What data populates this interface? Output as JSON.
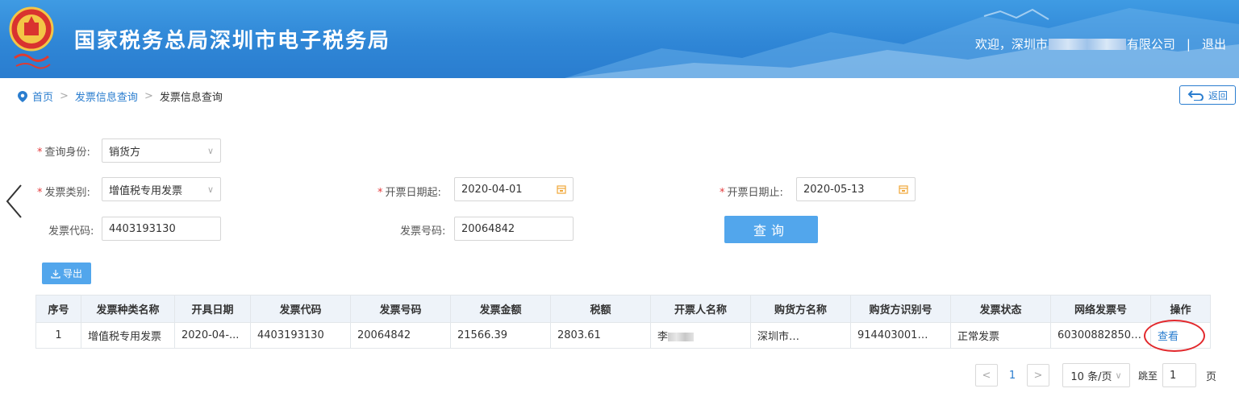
{
  "header": {
    "title": "国家税务总局深圳市电子税务局",
    "welcome_prefix": "欢迎，深圳市",
    "welcome_suffix": "有限公司",
    "separator": "|",
    "logout": "退出"
  },
  "breadcrumb": {
    "home": "首页",
    "separator": ">",
    "level1": "发票信息查询",
    "current": "发票信息查询"
  },
  "back_button": "返回",
  "form": {
    "identity_label": "查询身份:",
    "identity_value": "销货方",
    "type_label": "发票类别:",
    "type_value": "增值税专用发票",
    "start_label": "开票日期起:",
    "start_value": "2020-04-01",
    "end_label": "开票日期止:",
    "end_value": "2020-05-13",
    "code_label": "发票代码:",
    "code_value": "4403193130",
    "number_label": "发票号码:",
    "number_value": "20064842",
    "required_mark": "*",
    "query_button": "查询"
  },
  "export_button": "导出",
  "table": {
    "columns": [
      "序号",
      "发票种类名称",
      "开具日期",
      "发票代码",
      "发票号码",
      "发票金额",
      "税额",
      "开票人名称",
      "购货方名称",
      "购货方识别号",
      "发票状态",
      "网络发票号",
      "操作"
    ],
    "row": {
      "index": "1",
      "type": "增值税专用发票",
      "date": "2020-04-...",
      "code": "4403193130",
      "number": "20064842",
      "amount": "21566.39",
      "tax": "2803.61",
      "issuer": "李",
      "buyer": "深圳市",
      "buyer_suffix": ".",
      "buyer_id": "914403001",
      "buyer_id_suffix": "..",
      "status": "正常发票",
      "net_no": "603008828500...",
      "action": "查看"
    }
  },
  "pager": {
    "prev": "<",
    "page": "1",
    "next": ">",
    "size": "10 条/页",
    "size_chevron": "∨",
    "jump_label": "跳至",
    "jump_value": "1",
    "page_unit": "页"
  },
  "colors": {
    "header_blue": "#2f86d6",
    "link_blue": "#2a7dcf",
    "button_blue": "#52a6ec",
    "required_red": "#e4393c",
    "highlight_red": "#e2282c"
  }
}
